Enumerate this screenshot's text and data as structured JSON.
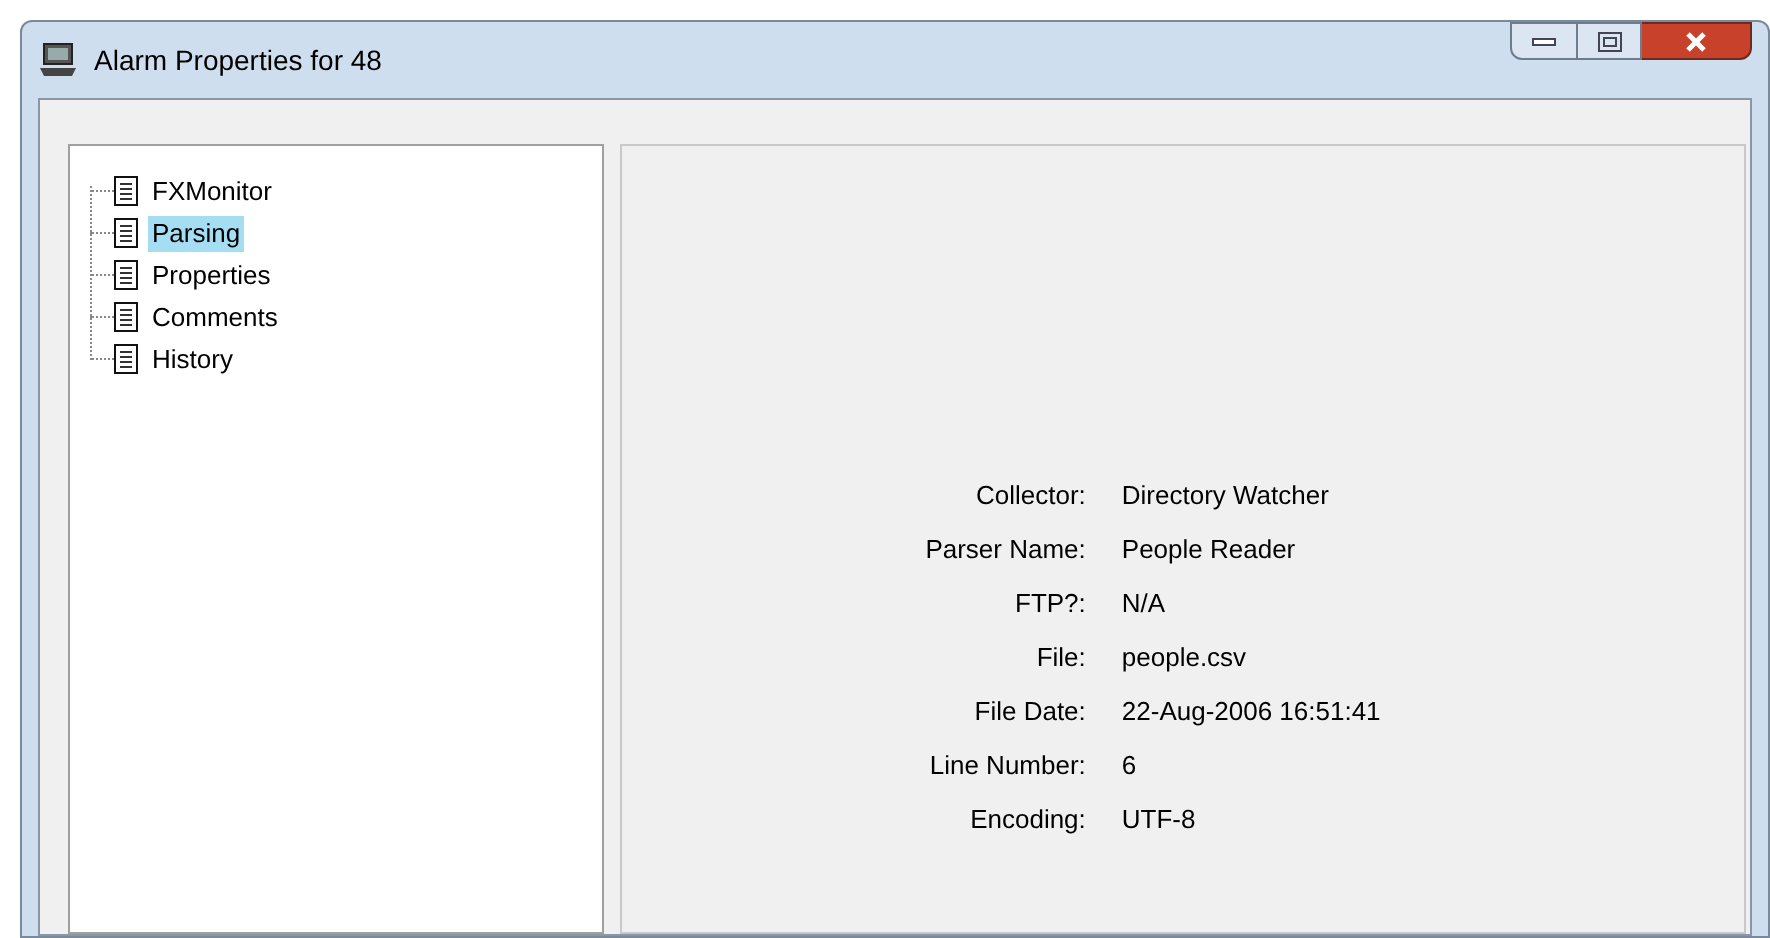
{
  "window": {
    "title": "Alarm Properties for 48"
  },
  "tree": {
    "items": [
      {
        "label": "FXMonitor",
        "selected": false
      },
      {
        "label": "Parsing",
        "selected": true
      },
      {
        "label": "Properties",
        "selected": false
      },
      {
        "label": "Comments",
        "selected": false
      },
      {
        "label": "History",
        "selected": false
      }
    ]
  },
  "details": [
    {
      "label": "Collector:",
      "value": "Directory Watcher"
    },
    {
      "label": "Parser Name:",
      "value": "People Reader"
    },
    {
      "label": "FTP?:",
      "value": "N/A"
    },
    {
      "label": "File:",
      "value": "people.csv"
    },
    {
      "label": "File Date:",
      "value": "22-Aug-2006 16:51:41"
    },
    {
      "label": "Line Number:",
      "value": "6"
    },
    {
      "label": "Encoding:",
      "value": "UTF-8"
    }
  ]
}
